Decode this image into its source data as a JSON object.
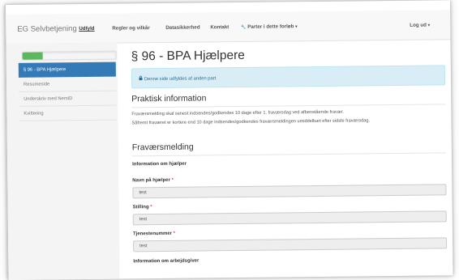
{
  "navbar": {
    "brand": "EG Selvbetjening",
    "items": [
      {
        "label": "Udfyld"
      },
      {
        "label": "Regler og vilkår"
      },
      {
        "label": "Datasikkerhed"
      },
      {
        "label": "Kontakt"
      },
      {
        "label": "Parter i dette forløb"
      }
    ],
    "logout_label": "Log ud",
    "caret": "▾",
    "wrench_icon": "🔧"
  },
  "progress": {
    "fraction": 0.22,
    "color": "#5cb85c"
  },
  "sidebar": {
    "items": [
      {
        "label": "§ 96 - BPA Hjælpere"
      },
      {
        "label": "Resumeside"
      },
      {
        "label": "Underskriv med NemID"
      },
      {
        "label": "Kvittering"
      }
    ]
  },
  "main": {
    "title": "§ 96 - BPA Hjælpere",
    "alert": {
      "icon": "lock-icon",
      "text": "Denne side udfyldes af anden part"
    },
    "practical_heading": "Praktisk information",
    "practical_lines": [
      "Fraværsmelding skal senest indsendes/godkendes 10 dage efter 1. fraværsdag ved afbenstående fravær.",
      "Såfremt fraværet er kortere end 10 dage indsendes/godkendes fraværsmeldingen umiddelbart efter sidste fraværsdag."
    ],
    "absence_heading": "Fraværsmelding",
    "helper_section_label": "Information om hjælper",
    "fields": [
      {
        "label": "Navn på hjælper",
        "required_mark": "*",
        "value": "test"
      },
      {
        "label": "Stilling",
        "required_mark": "*",
        "value": "test"
      },
      {
        "label": "Tjenestenummer",
        "required_mark": "*",
        "value": "test"
      }
    ],
    "employer_section_label": "Information om arbejdsgiver"
  },
  "colors": {
    "accent": "#337ab7",
    "alert_bg": "#d9edf7",
    "alert_text": "#31708f",
    "required": "#d9534f"
  }
}
